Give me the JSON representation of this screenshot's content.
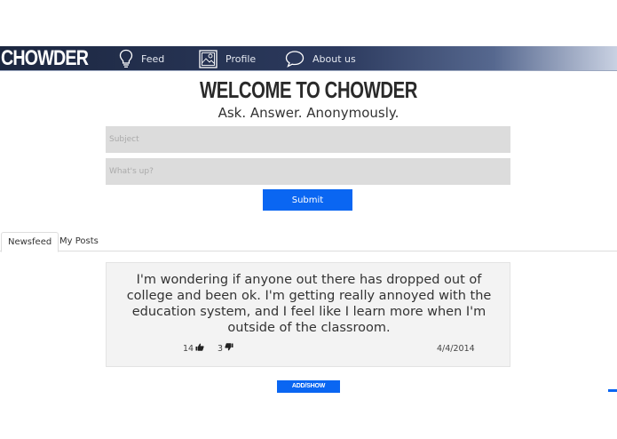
{
  "nav": {
    "brand": "CHOWDER",
    "items": [
      {
        "label": "Feed",
        "icon": "lightbulb-icon"
      },
      {
        "label": "Profile",
        "icon": "picture-icon"
      },
      {
        "label": "About us",
        "icon": "speech-bubble-icon"
      }
    ]
  },
  "hero": {
    "title": "WELCOME TO CHOWDER",
    "tagline": "Ask. Answer. Anonymously."
  },
  "form": {
    "subject_placeholder": "Subject",
    "body_placeholder": "What's up?",
    "submit_label": "Submit"
  },
  "tabs": [
    {
      "label": "Newsfeed",
      "active": true
    },
    {
      "label": "My Posts",
      "active": false
    }
  ],
  "posts": [
    {
      "body": "I'm wondering if anyone out there has dropped out of college and been ok. I'm getting really annoyed with the education system, and I feel like I learn more when I'm outside of the classroom.",
      "upvotes": "14",
      "downvotes": "3",
      "date": "4/4/2014",
      "comments_label": "ADD/SHOW COMMENTS"
    }
  ],
  "colors": {
    "accent": "#0a66f2",
    "navbar": "#2c3a5e",
    "field_bg": "#dcdcdc",
    "post_bg": "#f3f3f3"
  }
}
